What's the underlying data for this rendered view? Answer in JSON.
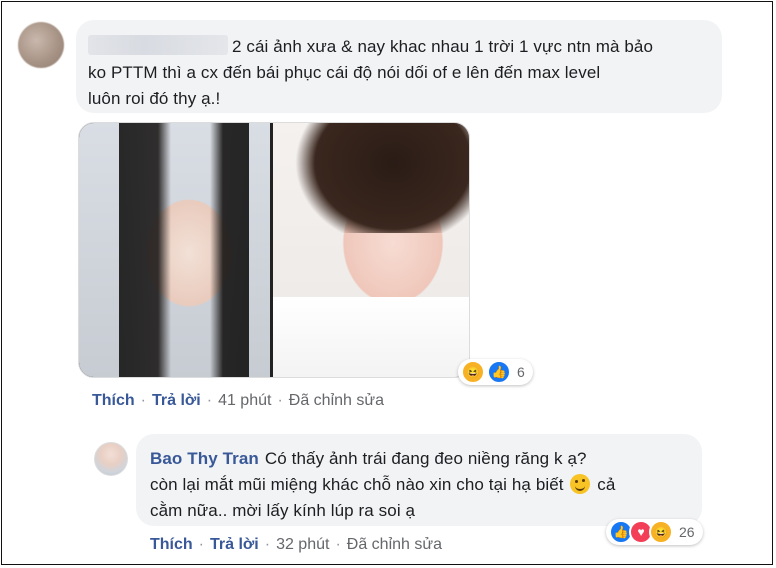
{
  "comment": {
    "text_line1": "2 cái ảnh xưa & nay khac nhau 1 trời 1 vực ntn mà bảo",
    "text_line2": "ko PTTM thì a cx đến bái phục cái độ nói dối of e lên đến max level",
    "text_line3": "luôn roi đó thy ạ.!",
    "reactions": {
      "icons": [
        "haha-icon",
        "like-icon"
      ],
      "count": "6"
    },
    "actions": {
      "like": "Thích",
      "reply": "Trả lời",
      "time": "41 phút",
      "edited": "Đã chỉnh sửa"
    }
  },
  "reply": {
    "author": "Bao Thy Tran",
    "text_line1": "Có thấy ảnh trái đang đeo niềng răng k ạ?",
    "text_line2a": "còn lại mắt mũi miệng khác chỗ nào xin cho tại hạ biết",
    "text_line2b": "cả",
    "text_line3": "cằm nữa.. mời lấy kính lúp ra soi ạ",
    "reactions": {
      "icons": [
        "like-icon",
        "love-icon",
        "haha-icon"
      ],
      "count": "26"
    },
    "actions": {
      "like": "Thích",
      "reply": "Trả lời",
      "time": "32 phút",
      "edited": "Đã chỉnh sửa"
    }
  },
  "separator": "·",
  "colors": {
    "link": "#385898",
    "bubble": "#f2f3f5",
    "like": "#1877f2",
    "love": "#f33e58",
    "haha": "#f7b125"
  }
}
